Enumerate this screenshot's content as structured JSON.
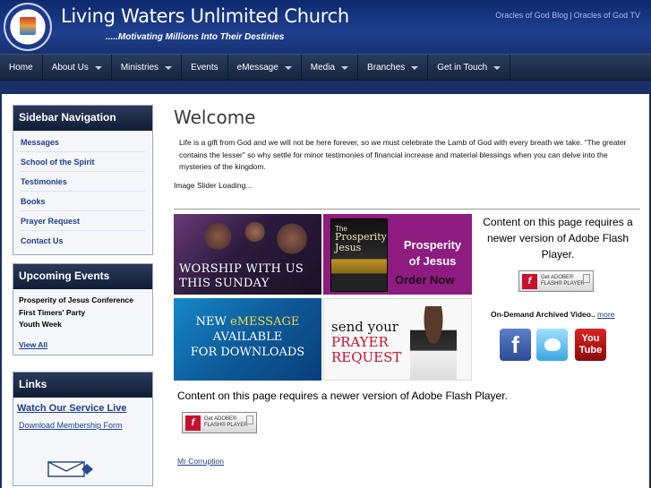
{
  "header": {
    "site_title": "Living Waters Unlimited Church",
    "tagline": ".....Motivating Millions Into Their Destinies",
    "top_links": [
      "Oracles of God Blog",
      "Oracles of God TV"
    ],
    "separator": "|"
  },
  "nav": {
    "items": [
      {
        "label": "Home",
        "dropdown": false
      },
      {
        "label": "About Us",
        "dropdown": true
      },
      {
        "label": "Ministries",
        "dropdown": true
      },
      {
        "label": "Events",
        "dropdown": false
      },
      {
        "label": "eMessage",
        "dropdown": true
      },
      {
        "label": "Media",
        "dropdown": true
      },
      {
        "label": "Branches",
        "dropdown": true
      },
      {
        "label": "Get in Touch",
        "dropdown": true
      }
    ]
  },
  "sidebar": {
    "nav_title": "Sidebar Navigation",
    "nav_items": [
      "Messages",
      "School of the Spirit",
      "Testimonies",
      "Books",
      "Prayer Request",
      "Contact Us"
    ],
    "events_title": "Upcoming Events",
    "events": [
      "Prosperity of Jesus Conference",
      "First Timers' Party",
      "Youth Week"
    ],
    "view_all": "View All",
    "links_title": "Links",
    "watch_live": "Watch Our Service Live",
    "download_form": "Download Membership Form"
  },
  "main": {
    "heading": "Welcome",
    "intro": "Life is a gift from God and we will not be here forever, so we must celebrate the Lamb of God with every breath we take. “The greater contains the lesser” so why settle for minor testimonies of financial increase and material blessings when you can delve into the mysteries of the kingdom.",
    "slider_loading": "Image Slider Loading...",
    "flash_message": "Content on this page requires a newer version of Adobe Flash Player.",
    "get_flash_line1": "Get ADOBE®",
    "get_flash_line2": "FLASH® PLAYER",
    "on_demand": "On-Demand Archived Video..",
    "more": "more",
    "mr_corruption": "Mr Corruption"
  },
  "banners": {
    "worship": [
      "WORSHIP WITH US",
      "THIS SUNDAY"
    ],
    "prosperity_book_the": "The",
    "prosperity_book_title": "Prosperity Jesus",
    "prosperity_title": "Prosperity of Jesus",
    "prosperity_cta": "Order Now",
    "emessage_new": "NEW",
    "emessage_word": "eMESSAGE",
    "emessage_rest": [
      "AVAILABLE",
      "FOR DOWNLOADS"
    ],
    "prayer_send": "send your",
    "prayer_words": [
      "PRAYER",
      "REQUEST"
    ]
  },
  "social": {
    "facebook_glyph": "f",
    "youtube": [
      "You",
      "Tube"
    ]
  },
  "colors": {
    "header_blue": "#1f3f8f",
    "nav_dark": "#16253f",
    "link_blue": "#1e3f8a",
    "prosperity_purple": "#8e1c80",
    "prayer_red": "#c8102e"
  }
}
